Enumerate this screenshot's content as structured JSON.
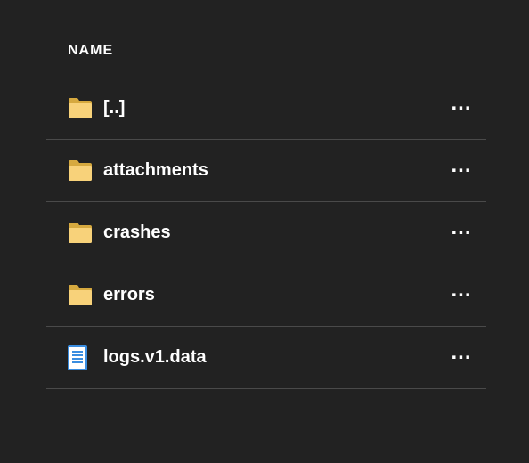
{
  "header": {
    "name_label": "NAME"
  },
  "rows": [
    {
      "icon": "folder",
      "name": "[..]"
    },
    {
      "icon": "folder",
      "name": "attachments"
    },
    {
      "icon": "folder",
      "name": "crashes"
    },
    {
      "icon": "folder",
      "name": "errors"
    },
    {
      "icon": "file",
      "name": "logs.v1.data"
    }
  ],
  "icons": {
    "more": "..."
  },
  "colors": {
    "bg": "#222222",
    "divider": "#4a4a4a",
    "text": "#ffffff",
    "folder_back": "#d6a93f",
    "folder_front": "#f8d27a",
    "file_paper": "#ffffff",
    "file_outline": "#3a8de0",
    "file_line": "#3a8de0"
  }
}
